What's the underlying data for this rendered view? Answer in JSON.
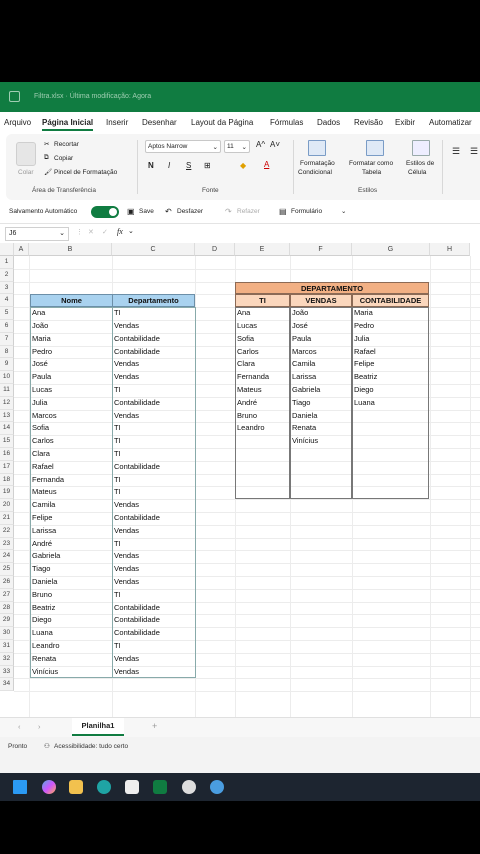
{
  "titlebar": {
    "file_name": "Filtra.xlsx",
    "modified": "Última modificação: Agora",
    "status_text": "Filtra.xlsx · Última modificação: Agora"
  },
  "tabs": [
    {
      "label": "Arquivo"
    },
    {
      "label": "Página Inicial",
      "active": true
    },
    {
      "label": "Inserir"
    },
    {
      "label": "Desenhar"
    },
    {
      "label": "Layout da Página"
    },
    {
      "label": "Fórmulas"
    },
    {
      "label": "Dados"
    },
    {
      "label": "Revisão"
    },
    {
      "label": "Exibir"
    },
    {
      "label": "Automatizar"
    }
  ],
  "ribbon": {
    "paste_label": "Colar",
    "cut_label": "Recortar",
    "copy_label": "Copiar",
    "format_painter_label": "Pincel de Formatação",
    "clipboard_group": "Área de Transferência",
    "font_name": "Aptos Narrow",
    "font_size": "11",
    "grow_font": "A^",
    "shrink_font": "A˅",
    "bold": "N",
    "italic": "I",
    "underline": "S",
    "font_group": "Fonte",
    "cond_format_label_1": "Formatação",
    "cond_format_label_2": "Condicional",
    "format_table_label_1": "Formatar como",
    "format_table_label_2": "Tabela",
    "cell_styles_label_1": "Estilos de",
    "cell_styles_label_2": "Célula",
    "styles_group": "Estilos"
  },
  "qat": {
    "autosave_label": "Salvamento Automático",
    "save_label": "Save",
    "undo_label": "Desfazer",
    "redo_label": "Refazer",
    "form_label": "Formulário"
  },
  "formula_bar": {
    "cell_ref": "J6",
    "fx": "fx",
    "value": ""
  },
  "columns": [
    "A",
    "B",
    "C",
    "D",
    "E",
    "F",
    "G",
    "H"
  ],
  "rows": [
    "1",
    "2",
    "3",
    "4",
    "5",
    "6",
    "7",
    "8",
    "9",
    "10",
    "11",
    "12",
    "13",
    "14",
    "15",
    "16",
    "17",
    "18",
    "19",
    "20",
    "21",
    "22",
    "23",
    "24",
    "25",
    "26",
    "27",
    "28",
    "29",
    "30",
    "31",
    "32",
    "33",
    "34"
  ],
  "table1": {
    "headers": [
      "Nome",
      "Departamento"
    ],
    "rows": [
      [
        "Ana",
        "TI"
      ],
      [
        "João",
        "Vendas"
      ],
      [
        "Maria",
        "Contabilidade"
      ],
      [
        "Pedro",
        "Contabilidade"
      ],
      [
        "José",
        "Vendas"
      ],
      [
        "Paula",
        "Vendas"
      ],
      [
        "Lucas",
        "TI"
      ],
      [
        "Julia",
        "Contabilidade"
      ],
      [
        "Marcos",
        "Vendas"
      ],
      [
        "Sofia",
        "TI"
      ],
      [
        "Carlos",
        "TI"
      ],
      [
        "Clara",
        "TI"
      ],
      [
        "Rafael",
        "Contabilidade"
      ],
      [
        "Fernanda",
        "TI"
      ],
      [
        "Mateus",
        "TI"
      ],
      [
        "Camila",
        "Vendas"
      ],
      [
        "Felipe",
        "Contabilidade"
      ],
      [
        "Larissa",
        "Vendas"
      ],
      [
        "André",
        "TI"
      ],
      [
        "Gabriela",
        "Vendas"
      ],
      [
        "Tiago",
        "Vendas"
      ],
      [
        "Daniela",
        "Vendas"
      ],
      [
        "Bruno",
        "TI"
      ],
      [
        "Beatriz",
        "Contabilidade"
      ],
      [
        "Diego",
        "Contabilidade"
      ],
      [
        "Luana",
        "Contabilidade"
      ],
      [
        "Leandro",
        "TI"
      ],
      [
        "Renata",
        "Vendas"
      ],
      [
        "Vinícius",
        "Vendas"
      ]
    ]
  },
  "table2": {
    "title": "DEPARTAMENTO",
    "headers": [
      "TI",
      "VENDAS",
      "CONTABILIDADE"
    ],
    "ti": [
      "Ana",
      "Lucas",
      "Sofia",
      "Carlos",
      "Clara",
      "Fernanda",
      "Mateus",
      "André",
      "Bruno",
      "Leandro"
    ],
    "vendas": [
      "João",
      "José",
      "Paula",
      "Marcos",
      "Camila",
      "Larissa",
      "Gabriela",
      "Tiago",
      "Daniela",
      "Renata",
      "Vinícius"
    ],
    "contabilidade": [
      "Maria",
      "Pedro",
      "Julia",
      "Rafael",
      "Felipe",
      "Beatriz",
      "Diego",
      "Luana"
    ]
  },
  "sheets": [
    {
      "label": "Planilha1"
    }
  ],
  "add_sheet": "+",
  "status": {
    "ready": "Pronto",
    "accessibility": "Acessibilidade: tudo certo"
  },
  "colors": {
    "excel_green": "#107c41",
    "header_blue": "#a9d2ef",
    "header_orange_dark": "#f2b084",
    "header_orange_light": "#fbd7bd"
  }
}
